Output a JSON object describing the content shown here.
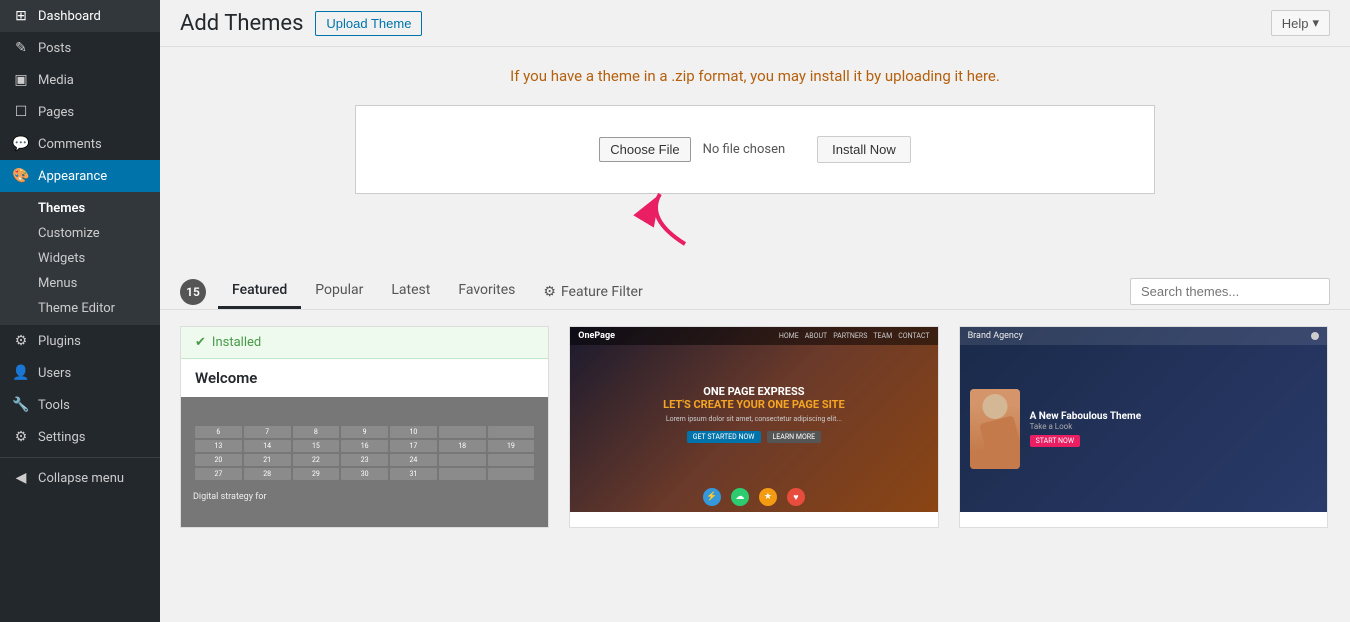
{
  "sidebar": {
    "items": [
      {
        "id": "dashboard",
        "label": "Dashboard",
        "icon": "⊞"
      },
      {
        "id": "posts",
        "label": "Posts",
        "icon": "✎"
      },
      {
        "id": "media",
        "label": "Media",
        "icon": "▣"
      },
      {
        "id": "pages",
        "label": "Pages",
        "icon": "⬜"
      },
      {
        "id": "comments",
        "label": "Comments",
        "icon": "💬"
      },
      {
        "id": "appearance",
        "label": "Appearance",
        "icon": "🎨",
        "active": true
      },
      {
        "id": "plugins",
        "label": "Plugins",
        "icon": "⚙"
      },
      {
        "id": "users",
        "label": "Users",
        "icon": "👤"
      },
      {
        "id": "tools",
        "label": "Tools",
        "icon": "🔧"
      },
      {
        "id": "settings",
        "label": "Settings",
        "icon": "⚙"
      }
    ],
    "appearance_sub": [
      {
        "id": "themes",
        "label": "Themes",
        "active": true
      },
      {
        "id": "customize",
        "label": "Customize"
      },
      {
        "id": "widgets",
        "label": "Widgets"
      },
      {
        "id": "menus",
        "label": "Menus"
      },
      {
        "id": "theme-editor",
        "label": "Theme Editor"
      }
    ],
    "collapse_label": "Collapse menu"
  },
  "header": {
    "page_title": "Add Themes",
    "upload_theme_label": "Upload Theme",
    "help_label": "Help"
  },
  "upload": {
    "info_text": "If you have a theme in a .zip format, you may install it by uploading it here.",
    "choose_file_label": "Choose File",
    "no_file_text": "No file chosen",
    "install_now_label": "Install Now"
  },
  "tabs": {
    "count": "15",
    "items": [
      {
        "id": "featured",
        "label": "Featured",
        "active": true
      },
      {
        "id": "popular",
        "label": "Popular"
      },
      {
        "id": "latest",
        "label": "Latest"
      },
      {
        "id": "favorites",
        "label": "Favorites"
      },
      {
        "id": "feature-filter",
        "label": "Feature Filter"
      }
    ],
    "search_placeholder": "Search themes..."
  },
  "themes": {
    "installed_label": "Installed",
    "theme1": {
      "name": "Welcome",
      "subtitle": "Digital strategy for",
      "status": "Installed"
    },
    "theme2": {
      "brand": "OnePage",
      "title": "ONE PAGE EXPRESS",
      "subtitle": "LET'S CREATE YOUR ONE PAGE SITE"
    },
    "theme3": {
      "brand": "Brand Agency",
      "title": "A New Faboulous Theme",
      "subtitle": "Take a Look"
    }
  }
}
